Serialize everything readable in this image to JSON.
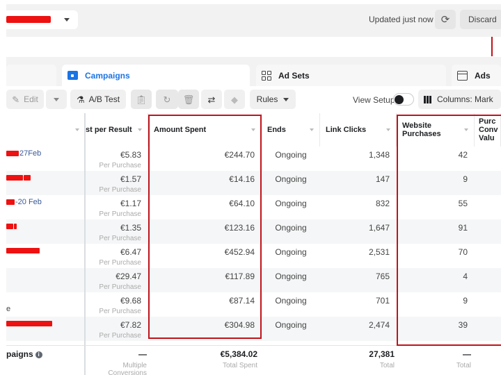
{
  "topbar": {
    "account_name": "[redacted account]",
    "updated_text": "Updated just now",
    "discard_label": "Discard"
  },
  "tabs": [
    {
      "label": "",
      "active": false
    },
    {
      "label": "Campaigns",
      "active": true,
      "icon": "folder-icon"
    },
    {
      "label": "Ad Sets",
      "active": false,
      "icon": "grid-icon"
    },
    {
      "label": "Ads",
      "active": false,
      "icon": "window-icon"
    }
  ],
  "toolbar": {
    "edit_label": "Edit",
    "ab_test_label": "A/B Test",
    "rules_label": "Rules",
    "view_setup_label": "View Setup",
    "view_setup_on": false,
    "columns_label": "Columns: Mark"
  },
  "table": {
    "columns": [
      {
        "key": "name",
        "label": ""
      },
      {
        "key": "cpr",
        "label": "st per Result"
      },
      {
        "key": "amount",
        "label": "Amount Spent"
      },
      {
        "key": "ends",
        "label": "Ends"
      },
      {
        "key": "clicks",
        "label": "Link Clicks"
      },
      {
        "key": "wp",
        "label": "Website Purchases"
      },
      {
        "key": "pcv",
        "label": "Purc Conv Valu"
      }
    ],
    "rows": [
      {
        "name": "27Feb",
        "cpr": "€5.83",
        "cpr_sub": "Per Purchase",
        "amount": "€244.70",
        "ends": "Ongoing",
        "clicks": "1,348",
        "wp": "42"
      },
      {
        "name": "",
        "cpr": "€1.57",
        "cpr_sub": "Per Purchase",
        "amount": "€14.16",
        "ends": "Ongoing",
        "clicks": "147",
        "wp": "9"
      },
      {
        "name": "-20 Feb",
        "cpr": "€1.17",
        "cpr_sub": "Per Purchase",
        "amount": "€64.10",
        "ends": "Ongoing",
        "clicks": "832",
        "wp": "55"
      },
      {
        "name": "",
        "cpr": "€1.35",
        "cpr_sub": "Per Purchase",
        "amount": "€123.16",
        "ends": "Ongoing",
        "clicks": "1,647",
        "wp": "91"
      },
      {
        "name": "",
        "cpr": "€6.47",
        "cpr_sub": "Per Purchase",
        "amount": "€452.94",
        "ends": "Ongoing",
        "clicks": "2,531",
        "wp": "70"
      },
      {
        "name": "",
        "cpr": "€29.47",
        "cpr_sub": "Per Purchase",
        "amount": "€117.89",
        "ends": "Ongoing",
        "clicks": "765",
        "wp": "4"
      },
      {
        "name": "e",
        "cpr": "€9.68",
        "cpr_sub": "Per Purchase",
        "amount": "€87.14",
        "ends": "Ongoing",
        "clicks": "701",
        "wp": "9"
      },
      {
        "name": "",
        "cpr": "€7.82",
        "cpr_sub": "Per Purchase",
        "amount": "€304.98",
        "ends": "Ongoing",
        "clicks": "2,474",
        "wp": "39"
      }
    ],
    "footer": {
      "name": "paigns",
      "cpr": "—",
      "cpr_sub": "Multiple Conversions",
      "amount": "€5,384.02",
      "amount_sub": "Total Spent",
      "clicks": "27,381",
      "clicks_sub": "Total",
      "wp": "—",
      "wp_sub": "Total"
    }
  },
  "colors": {
    "accent": "#1b74e4",
    "highlight": "#c0121a",
    "redaction": "#ee1111"
  }
}
